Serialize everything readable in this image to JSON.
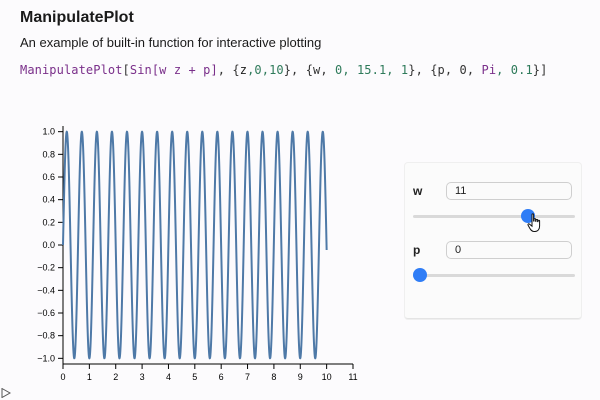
{
  "page": {
    "title": "ManipulatePlot",
    "subtitle": "An example of built-in function for interactive plotting"
  },
  "code": {
    "fn": "ManipulatePlot",
    "open": "[",
    "expr": "Sin[w z + p]",
    "arg_z_open": ", {",
    "arg_z_var": "z",
    "arg_z_range": ",0,10",
    "arg_w": "}, {w, ",
    "arg_w_nums": "0, 15.1, 1",
    "arg_p": "}, {p, 0, ",
    "arg_p_pi": "Pi",
    "arg_p_step": ", 0.1",
    "close": "}]"
  },
  "controls": {
    "w": {
      "label": "w",
      "value": "11",
      "min": 0,
      "max": 15.1,
      "step": 1,
      "current": 11
    },
    "p": {
      "label": "p",
      "value": "0",
      "min": 0,
      "max": 3.14159,
      "step": 0.1,
      "current": 0
    }
  },
  "colors": {
    "line": "#4e79a7",
    "accent": "#2f7df6"
  },
  "icons": {
    "play": "play-triangle-icon",
    "cursor": "hand-pointer-icon"
  },
  "chart_data": {
    "type": "line",
    "function": "sin(w*z + p)",
    "x_range": [
      0,
      10
    ],
    "w": 11,
    "p": 0,
    "xlim": [
      0,
      11
    ],
    "ylim": [
      -1.05,
      1.05
    ],
    "x_ticks": [
      "0",
      "1",
      "2",
      "3",
      "4",
      "5",
      "6",
      "7",
      "8",
      "9",
      "10",
      "11"
    ],
    "y_ticks": [
      "1.0",
      "0.8",
      "0.6",
      "0.4",
      "0.2",
      "0.0",
      "−0.2",
      "−0.4",
      "−0.6",
      "−0.8",
      "−1.0"
    ],
    "y_tick_values": [
      1.0,
      0.8,
      0.6,
      0.4,
      0.2,
      0.0,
      -0.2,
      -0.4,
      -0.6,
      -0.8,
      -1.0
    ],
    "x_tick_values": [
      0,
      1,
      2,
      3,
      4,
      5,
      6,
      7,
      8,
      9,
      10,
      11
    ],
    "grid": false
  }
}
